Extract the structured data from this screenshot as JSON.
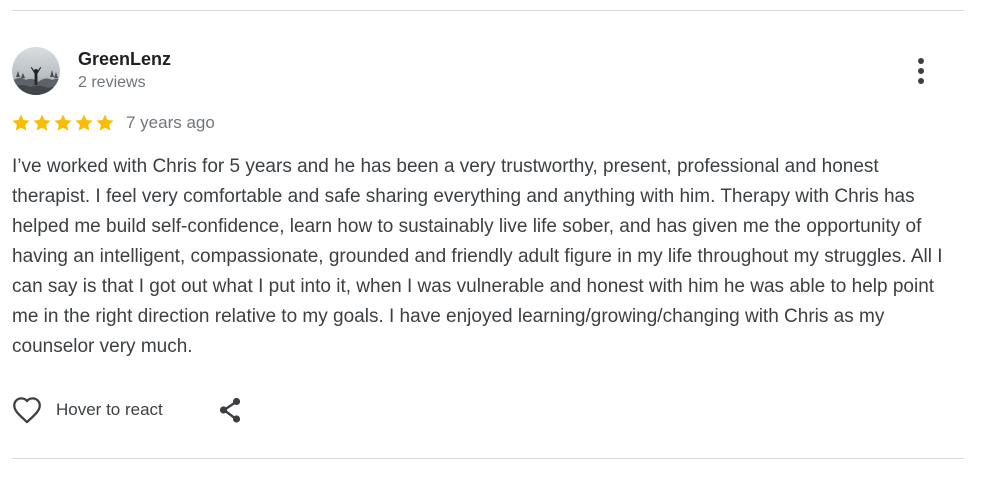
{
  "review": {
    "author": {
      "name": "GreenLenz",
      "reviews_count": "2 reviews"
    },
    "rating": 5,
    "max_rating": 5,
    "date": "7 years ago",
    "text": "I’ve worked with Chris for 5 years and he has been a very trustworthy, present, professional and honest therapist. I feel very comfortable and safe sharing everything and anything with him. Therapy with Chris has helped me build self-confidence, learn how to sustainably live life sober, and has given me the opportunity of having an intelligent, compassionate, grounded and friendly adult figure in my life throughout my struggles. All I can say is that I got out what I put into it, when I was vulnerable and honest with him he was able to help point me in the right direction relative to my goals. I have enjoyed learning/growing/changing with Chris as my counselor very much.",
    "actions": {
      "react_label": "Hover to react"
    }
  },
  "icons": {
    "more": "more-vert-icon",
    "star": "star-icon",
    "react": "heart-icon",
    "share": "share-icon"
  },
  "colors": {
    "star": "#fbbc04",
    "name": "#202124",
    "meta": "#70757a",
    "text": "#3c4043",
    "divider": "#dadce0"
  }
}
